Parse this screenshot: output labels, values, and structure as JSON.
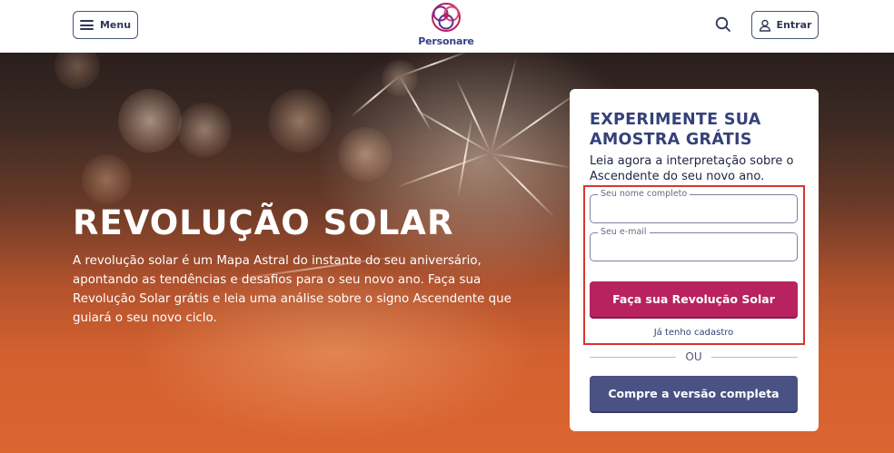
{
  "header": {
    "menu_label": "Menu",
    "logo_text": "Personare",
    "login_label": "Entrar"
  },
  "hero": {
    "title": "REVOLUÇÃO SOLAR",
    "description": "A revolução solar é um Mapa Astral do instante do seu aniversário, apontando as tendências e desafios para o seu novo ano. Faça sua Revolução Solar grátis e leia uma análise sobre o signo Ascendente que guiará o seu novo ciclo."
  },
  "card": {
    "title": "EXPERIMENTE SUA AMOSTRA GRÁTIS",
    "subtitle": "Leia agora a interpretação sobre o Ascendente do seu novo ano.",
    "name_label": "Seu nome completo",
    "name_value": "",
    "email_label": "Seu e-mail",
    "email_value": "",
    "submit_label": "Faça sua Revolução Solar",
    "existing_account_link": "Já tenho cadastro",
    "or_text": "OU",
    "buy_label": "Compre a versão completa"
  },
  "colors": {
    "brand_navy": "#35417a",
    "primary_button": "#b8225f",
    "secondary_button": "#4a5183",
    "highlight_border": "#d9352d"
  },
  "icons": [
    "menu-icon",
    "personare-logo-icon",
    "search-icon",
    "user-icon"
  ]
}
